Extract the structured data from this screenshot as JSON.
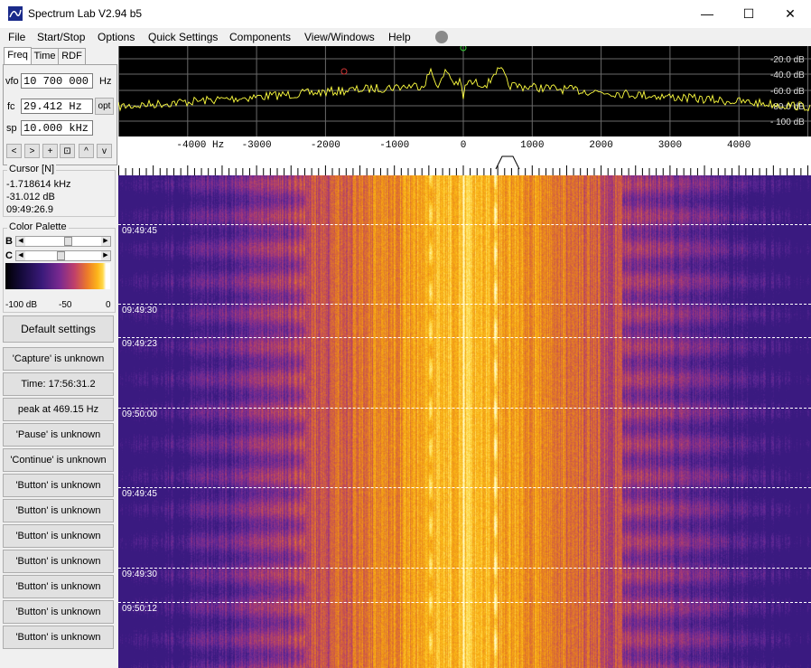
{
  "window": {
    "title": "Spectrum Lab V2.94 b5",
    "minimize": "—",
    "maximize": "☐",
    "close": "✕"
  },
  "menu": [
    {
      "label": "File"
    },
    {
      "label": "Start/Stop"
    },
    {
      "label": "Options"
    },
    {
      "label": "Quick Settings"
    },
    {
      "label": "Components"
    },
    {
      "label": "View/Windows"
    },
    {
      "label": "Help"
    }
  ],
  "tabs": [
    {
      "label": "Freq"
    },
    {
      "label": "Time"
    },
    {
      "label": "RDF"
    }
  ],
  "freq": {
    "vfo_label": "vfo",
    "vfo_value": "10 700 000",
    "vfo_unit": "Hz",
    "fc_label": "fc",
    "fc_value": "29.412 Hz",
    "fc_button": "opt",
    "sp_label": "sp",
    "sp_value": "10.000 kHz",
    "nav_buttons": [
      "<",
      ">",
      "+",
      "⊡",
      "^",
      "v"
    ]
  },
  "cursor": {
    "title": "Cursor [N]",
    "freq": "-1.718614 kHz",
    "level": "-31.012 dB",
    "time": "09:49:26.9"
  },
  "palette": {
    "title": "Color Palette",
    "b_label": "B",
    "c_label": "C",
    "scale_min": "-100 dB",
    "scale_mid": "-50",
    "scale_max": "0",
    "brightness": 0.55,
    "contrast": 0.45
  },
  "buttons": [
    "Default settings",
    "'Capture' is unknown",
    "Time:  17:56:31.2",
    "peak at 469.15 Hz",
    "'Pause' is unknown",
    "'Continue' is unknown",
    "'Button' is unknown",
    "'Button' is unknown",
    "'Button' is unknown",
    "'Button' is unknown",
    "'Button' is unknown",
    "'Button' is unknown",
    "'Button' is unknown"
  ],
  "spectrum": {
    "db_labels": [
      "-20.0 dB",
      "-40.0 dB",
      "-60.0 dB",
      "-80.0 dB",
      "- 100 dB"
    ]
  },
  "freq_scale": {
    "labels": [
      "-4000 Hz",
      "-3000",
      "-2000",
      "-1000",
      "0",
      "1000",
      "2000",
      "3000",
      "4000"
    ]
  },
  "waterfall": {
    "timestamps": [
      "09:49:45",
      "09:49:30",
      "09:49:23",
      "09:50:00",
      "09:49:45",
      "09:49:30",
      "09:50:12"
    ]
  },
  "colors": {
    "trace": "#ffff40",
    "grid": "#6a6a6a",
    "status_dot": "#8a8a8a"
  }
}
